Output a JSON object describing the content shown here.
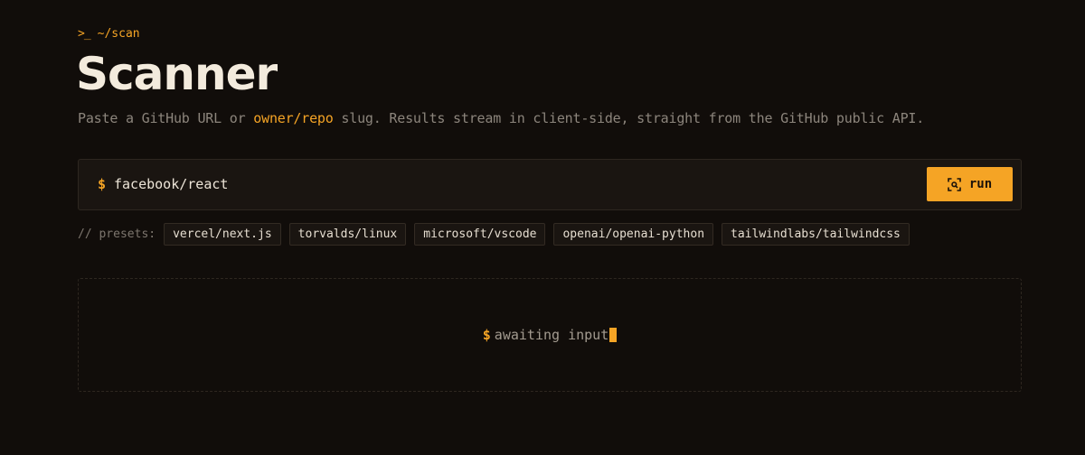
{
  "breadcrumb": {
    "prompt": ">_",
    "path": "~/scan"
  },
  "header": {
    "title": "Scanner"
  },
  "subtitle": {
    "before": "Paste a GitHub URL or ",
    "highlight": "owner/repo",
    "after": " slug. Results stream in client-side, straight from the GitHub public API."
  },
  "input": {
    "prompt": "$",
    "value": "facebook/react",
    "run_label": "run",
    "run_icon": "scan-icon"
  },
  "presets": {
    "label": "// presets:",
    "items": [
      "vercel/next.js",
      "torvalds/linux",
      "microsoft/vscode",
      "openai/openai-python",
      "tailwindlabs/tailwindcss"
    ]
  },
  "output": {
    "prompt": "$",
    "status": "awaiting input"
  },
  "colors": {
    "accent": "#f5a425",
    "background": "#110d0a",
    "panel": "#1a1511"
  }
}
